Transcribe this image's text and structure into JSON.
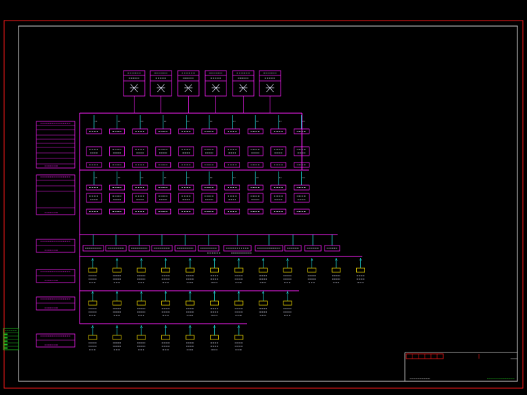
{
  "colors": {
    "background": "#000000",
    "outer_border": "#ff1a1a",
    "inner_border": "#d8d8d8",
    "bus": "#ff20ff",
    "panel_stroke": "#ff20ff",
    "feeder": "#1fd2d2",
    "load_box": "#e6d000",
    "label_text": "#e8e8ff",
    "legend_green": "#21d321"
  },
  "transformers": {
    "count": 6,
    "labels": [
      "",
      "",
      "",
      "",
      "",
      ""
    ]
  },
  "left_panels": [
    {
      "id": "p1",
      "rows": [
        "",
        "",
        "",
        "",
        "",
        ""
      ]
    },
    {
      "id": "p2",
      "rows": [
        "",
        "",
        "",
        "",
        ""
      ]
    },
    {
      "id": "p3",
      "rows": [
        "",
        ""
      ]
    },
    {
      "id": "p4",
      "rows": [
        "",
        ""
      ]
    },
    {
      "id": "p5",
      "rows": [
        "",
        ""
      ]
    },
    {
      "id": "p6",
      "rows": [
        "",
        ""
      ]
    }
  ],
  "lv_bus_section_1": {
    "feeder_count": 10
  },
  "lv_bus_section_2": {
    "feeder_count": 10
  },
  "distribution_row": {
    "feeder_count": 12,
    "wide_boxes": [
      7,
      8
    ]
  },
  "load_row_1": {
    "count": 12
  },
  "load_row_2": {
    "count": 9
  },
  "load_row_3": {
    "count": 7
  },
  "legend": {
    "rows": 5
  },
  "title_block": {
    "cells": 6
  }
}
